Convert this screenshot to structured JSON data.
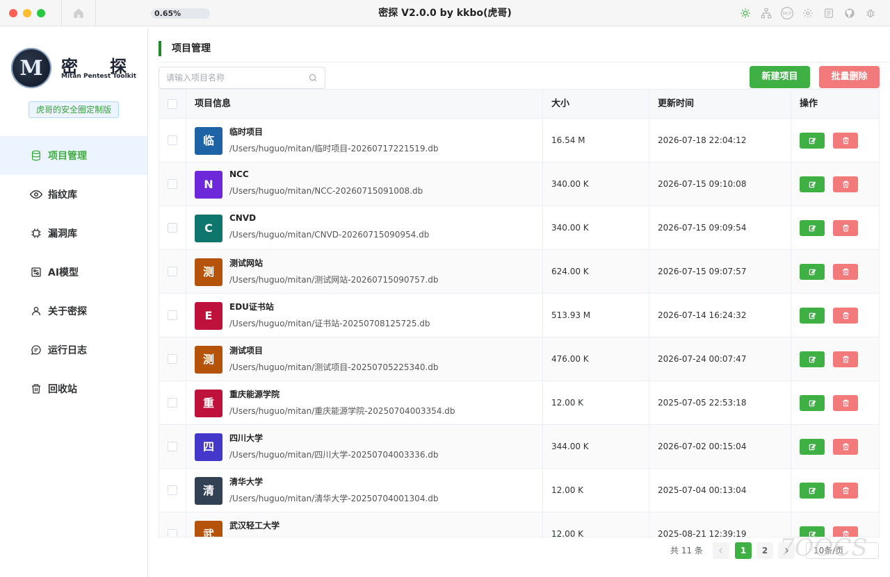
{
  "window": {
    "title": "密探 V2.0.0 by kkbo(虎哥)",
    "progress_text": "0.65%",
    "progress_percent": 0.65
  },
  "toolbar_icons": [
    "sun-icon",
    "network-icon",
    "mcp-icon",
    "gear-icon",
    "document-icon",
    "github-icon",
    "bug-icon"
  ],
  "toolbar_mcp_label": "MCP",
  "brand": {
    "logo_letter": "M",
    "name_1": "密",
    "name_2": "探",
    "subtitle": "Mitan Pentest Toolkit",
    "edition": "虎哥的安全圈定制版"
  },
  "colors": {
    "accent": "#3eb044",
    "danger": "#f37a7a",
    "active_bg": "#ecf5ff"
  },
  "sidebar": {
    "items": [
      {
        "label": "项目管理",
        "icon": "database-icon",
        "active": true
      },
      {
        "label": "指纹库",
        "icon": "eye-icon",
        "active": false
      },
      {
        "label": "漏洞库",
        "icon": "chip-icon",
        "active": false
      },
      {
        "label": "AI模型",
        "icon": "sliders-icon",
        "active": false
      },
      {
        "label": "关于密探",
        "icon": "user-icon",
        "active": false
      },
      {
        "label": "运行日志",
        "icon": "chat-icon",
        "active": false
      },
      {
        "label": "回收站",
        "icon": "trash-icon",
        "active": false
      }
    ]
  },
  "main": {
    "section_title": "项目管理",
    "search_placeholder": "请输入项目名称",
    "new_button": "新建项目",
    "batch_delete_button": "批量删除"
  },
  "table": {
    "headers": [
      "项目信息",
      "大小",
      "更新时间",
      "操作"
    ],
    "rows": [
      {
        "avatar": "临",
        "color": "#1e63a5",
        "name": "临时项目",
        "path": "/Users/huguo/mitan/临时项目-20260717221519.db",
        "size": "16.54 M",
        "time": "2026-07-18 22:04:12"
      },
      {
        "avatar": "N",
        "color": "#6d28d9",
        "name": "NCC",
        "path": "/Users/huguo/mitan/NCC-20260715091008.db",
        "size": "340.00 K",
        "time": "2026-07-15 09:10:08"
      },
      {
        "avatar": "C",
        "color": "#0f766e",
        "name": "CNVD",
        "path": "/Users/huguo/mitan/CNVD-20260715090954.db",
        "size": "340.00 K",
        "time": "2026-07-15 09:09:54"
      },
      {
        "avatar": "测",
        "color": "#b45309",
        "name": "测试网站",
        "path": "/Users/huguo/mitan/测试网站-20260715090757.db",
        "size": "624.00 K",
        "time": "2026-07-15 09:07:57"
      },
      {
        "avatar": "E",
        "color": "#be123c",
        "name": "EDU证书站",
        "path": "/Users/huguo/mitan/证书站-20250708125725.db",
        "size": "513.93 M",
        "time": "2026-07-14 16:24:32"
      },
      {
        "avatar": "测",
        "color": "#b45309",
        "name": "测试项目",
        "path": "/Users/huguo/mitan/测试项目-20250705225340.db",
        "size": "476.00 K",
        "time": "2026-07-24 00:07:47"
      },
      {
        "avatar": "重",
        "color": "#be123c",
        "name": "重庆能源学院",
        "path": "/Users/huguo/mitan/重庆能源学院-20250704003354.db",
        "size": "12.00 K",
        "time": "2025-07-05 22:53:18"
      },
      {
        "avatar": "四",
        "color": "#4338ca",
        "name": "四川大学",
        "path": "/Users/huguo/mitan/四川大学-20250704003336.db",
        "size": "344.00 K",
        "time": "2026-07-02 00:15:04"
      },
      {
        "avatar": "清",
        "color": "#334155",
        "name": "清华大学",
        "path": "/Users/huguo/mitan/清华大学-20250704001304.db",
        "size": "12.00 K",
        "time": "2025-07-04 00:13:04"
      },
      {
        "avatar": "武",
        "color": "#b45309",
        "name": "武汉轻工大学",
        "path": "",
        "size": "12.00 K",
        "time": "2025-08-21 12:39:19"
      }
    ]
  },
  "pagination": {
    "total": "共 11 条",
    "pages": [
      "1",
      "2"
    ],
    "current": "1",
    "page_size": "10条/页"
  },
  "watermark": "7OOCS"
}
